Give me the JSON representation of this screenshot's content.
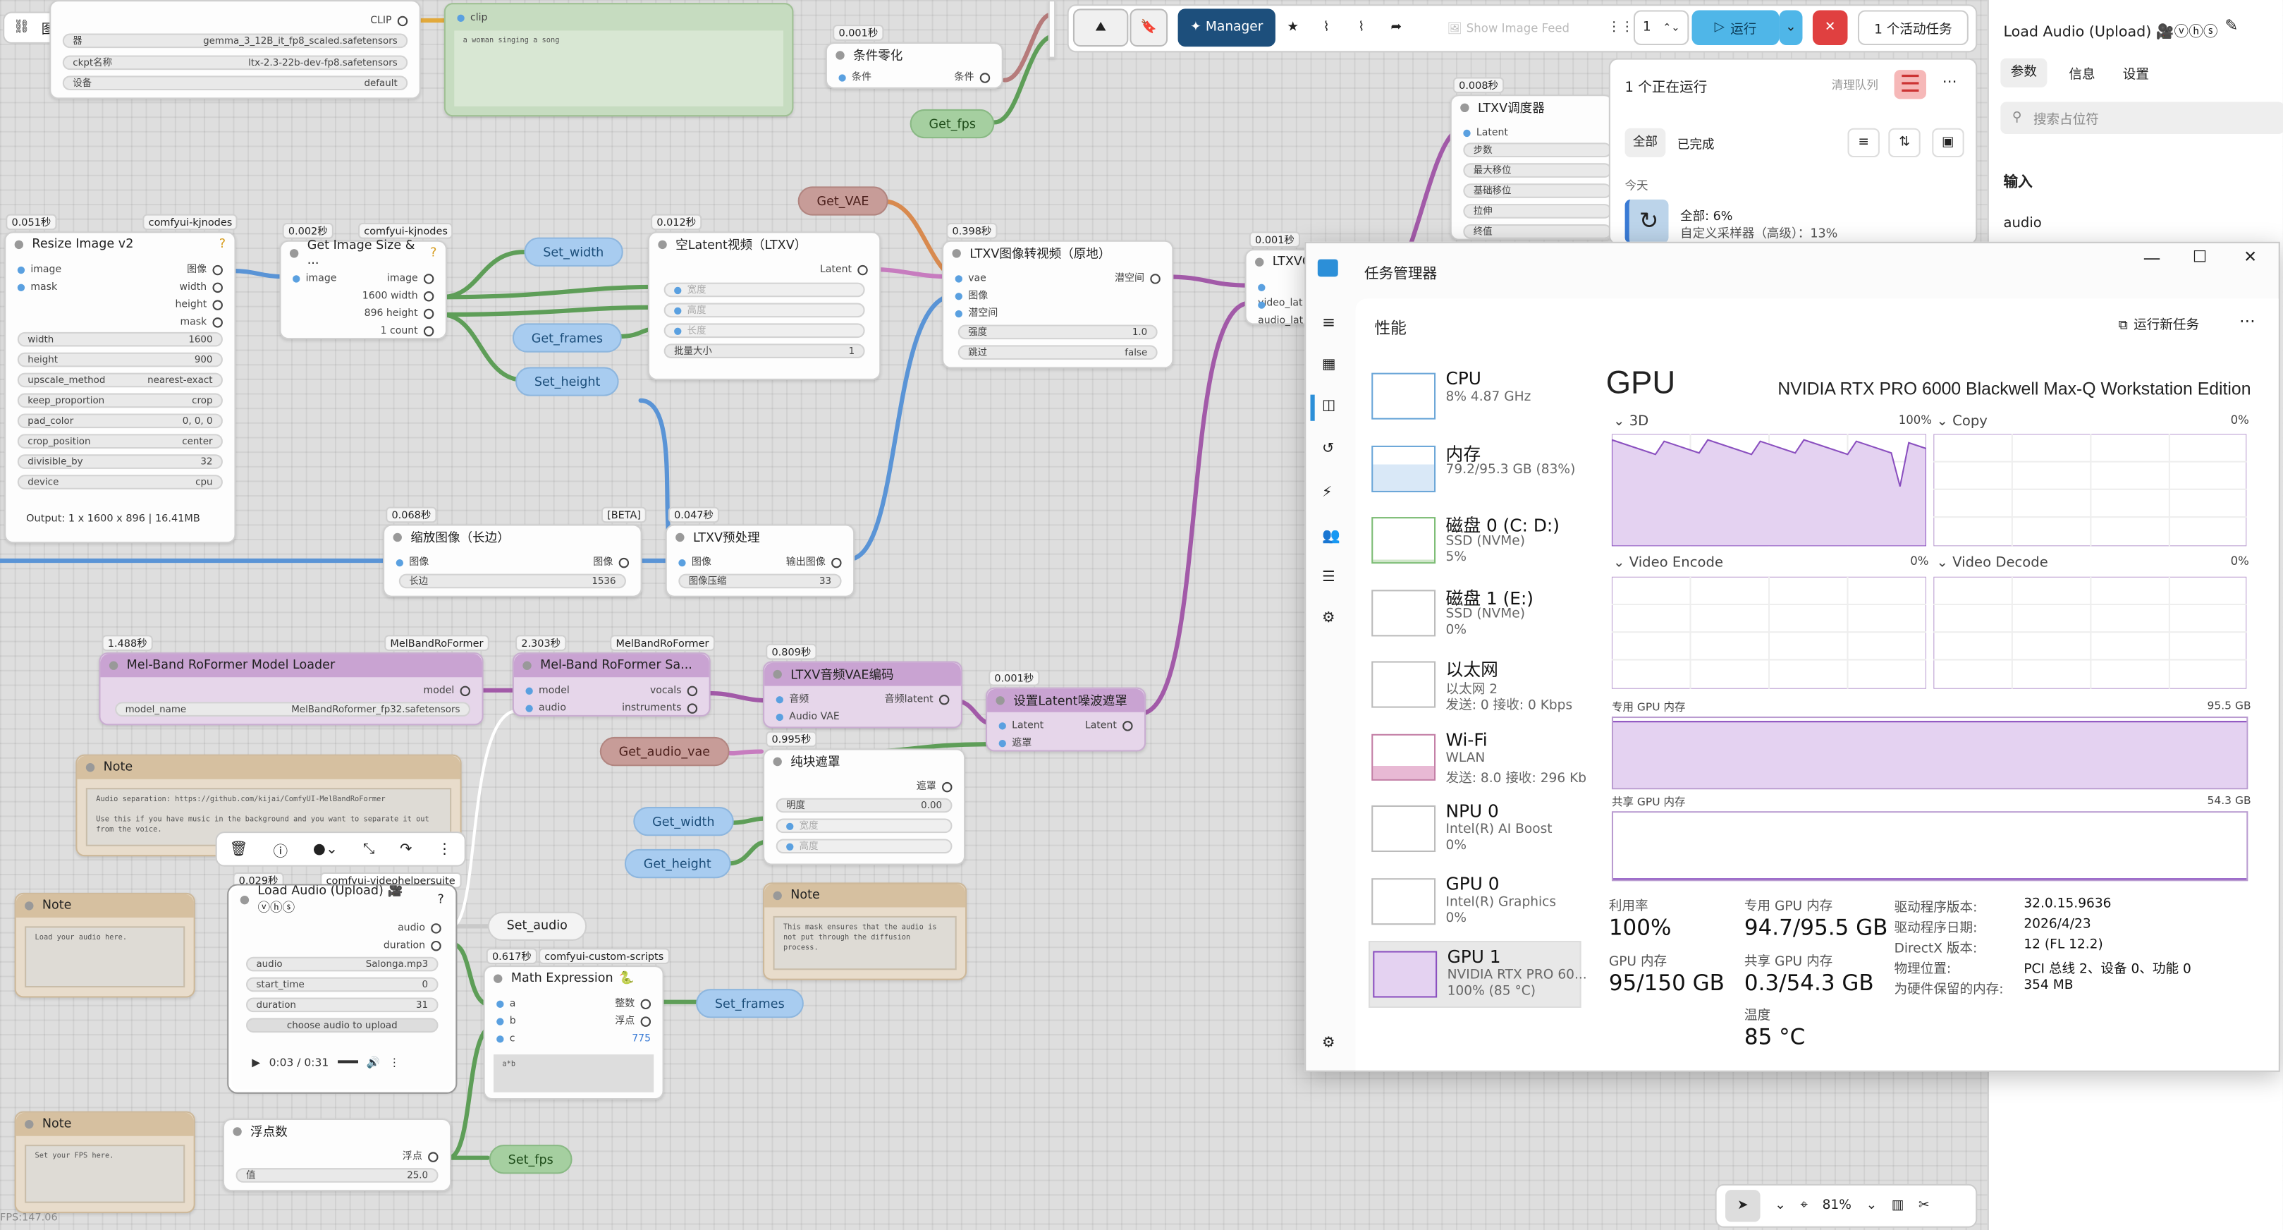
{
  "canvas": {
    "graph_menu": "图形",
    "wires_color": "#7e9e74",
    "nodes": {
      "loader_top": {
        "label_clip": "CLIP",
        "ckpt_value": "gemma_3_12B_it_fp8_scaled.safetensors",
        "ckpt_label": "ckpt名称",
        "ckpt_value2": "ltx-2.3-22b-dev-fp8.safetensors",
        "device_label": "设备",
        "device_value": "default",
        "w1_prefix": "器"
      },
      "prompt": {
        "clip": "clip",
        "text": "a woman singing a song"
      },
      "cond_zero": {
        "time": "0.001秒",
        "title": "条件零化",
        "in": "条件",
        "out": "条件"
      },
      "get_fps": "Get_fps",
      "resize": {
        "time": "0.051秒",
        "pack": "comfyui-kjnodes",
        "title": "Resize Image v2",
        "in1": "image",
        "in2": "mask",
        "out1": "图像",
        "out2": "width",
        "out3": "height",
        "out4": "mask",
        "widgets": [
          [
            "width",
            "1600"
          ],
          [
            "height",
            "900"
          ],
          [
            "upscale_method",
            "nearest-exact"
          ],
          [
            "keep_proportion",
            "crop"
          ],
          [
            "pad_color",
            "0, 0, 0"
          ],
          [
            "crop_position",
            "center"
          ],
          [
            "divisible_by",
            "32"
          ],
          [
            "device",
            "cpu"
          ]
        ],
        "output_text": "Output: 1 x 1600 x 896 | 16.41MB"
      },
      "getsize": {
        "time": "0.002秒",
        "pack": "comfyui-kjnodes",
        "title": "Get Image Size & ...",
        "in": "image",
        "out1": "image",
        "out2": "1600 width",
        "out3": "896 height",
        "out4": "1 count"
      },
      "set_width": "Set_width",
      "get_frames": "Get_frames",
      "set_height": "Set_height",
      "empty_latent": {
        "time": "0.012秒",
        "title": "空Latent视频（LTXV）",
        "out": "Latent",
        "w1": "宽度",
        "w2": "高度",
        "w3": "长度",
        "w4": "批量大小",
        "w4v": "1"
      },
      "get_vae": "Get_VAE",
      "img2vid": {
        "time": "0.398秒",
        "title": "LTXV图像转视频（原地）",
        "in1": "vae",
        "in2": "图像",
        "in3": "潜空间",
        "out": "潜空间",
        "w1": "强度",
        "w1v": "1.0",
        "w2": "跳过",
        "w2v": "false"
      },
      "ltxvc": {
        "time": "0.001秒",
        "title": "LTXVC",
        "in1": "video_lat",
        "in2": "audio_lat"
      },
      "scheduler": {
        "time": "0.008秒",
        "title": "LTXV调度器",
        "in": "Latent",
        "w": [
          "步数",
          "最大移位",
          "基础移位",
          "拉伸",
          "终值"
        ]
      },
      "scale": {
        "time": "0.068秒",
        "beta": "[BETA]",
        "title": "缩放图像（长边）",
        "in": "图像",
        "out": "图像",
        "w": "长边",
        "wv": "1536"
      },
      "preproc": {
        "time": "0.047秒",
        "title": "LTXV预处理",
        "in": "图像",
        "out": "输出图像",
        "w": "图像压缩",
        "wv": "33"
      },
      "mel_loader": {
        "time": "1.488秒",
        "pack": "MelBandRoFormer",
        "title": "Mel-Band RoFormer Model Loader",
        "out": "model",
        "w": "model_name",
        "wv": "MelBandRoformer_fp32.safetensors"
      },
      "mel_sampler": {
        "time": "2.303秒",
        "pack": "MelBandRoFormer",
        "title": "Mel-Band RoFormer Sa...",
        "in1": "model",
        "in2": "audio",
        "out1": "vocals",
        "out2": "instruments"
      },
      "audio_vae": {
        "time": "0.809秒",
        "title": "LTXV音频VAE编码",
        "in1": "音频",
        "in2": "Audio VAE",
        "out": "音频latent"
      },
      "get_audio_vae": "Get_audio_vae",
      "noise_mask": {
        "time": "0.001秒",
        "title": "设置Latent噪波遮罩",
        "in1": "Latent",
        "in2": "遮罩",
        "out": "Latent"
      },
      "solid_mask": {
        "time": "0.995秒",
        "title": "纯块遮罩",
        "out": "遮罩",
        "w1": "明度",
        "w1v": "0.00",
        "w2": "宽度",
        "w3": "高度"
      },
      "get_width": "Get_width",
      "get_height": "Get_height",
      "note1": {
        "title": "Note",
        "text": "Audio separation: https://github.com/kijai/ComfyUI-MelBandRoFormer\n\nUse this if you have music in the background and you want to separate it out from the voice."
      },
      "note2": {
        "title": "Note",
        "text": "Load your audio here."
      },
      "note3": {
        "title": "Note",
        "text": "This mask ensures that the audio is not put through the diffusion process."
      },
      "note4": {
        "title": "Note",
        "text": "Set your FPS here."
      },
      "load_audio": {
        "time": "0.029秒",
        "pack": "comfyui-videohelpersuite",
        "title": "Load Audio (Upload) 🎥ⓥⓗⓢ",
        "out1": "audio",
        "out2": "duration",
        "w": [
          [
            "audio",
            "Salonga.mp3"
          ],
          [
            "start_time",
            "0"
          ],
          [
            "duration",
            "31"
          ]
        ],
        "upload": "choose audio to upload",
        "player_time": "0:03 / 0:31"
      },
      "set_audio": "Set_audio",
      "math": {
        "time": "0.617秒",
        "pack": "comfyui-custom-scripts",
        "title": "Math Expression",
        "in1": "a",
        "in2": "b",
        "in3": "c",
        "out1": "整数",
        "out2": "浮点",
        "result": "775",
        "expr": "a*b"
      },
      "set_frames": "Set_frames",
      "float_node": {
        "title": "浮点数",
        "out": "浮点",
        "w": "值",
        "wv": "25.0"
      },
      "set_fps": "Set_fps",
      "fps_readout": "FPS:147.06"
    }
  },
  "toolbar": {
    "manager": "Manager",
    "show_image_feed": "Show Image Feed",
    "queue_count": "1",
    "run": "运行",
    "active_tasks": "1 个活动任务"
  },
  "queue": {
    "title": "1 个正在运行",
    "clear": "清理队列",
    "tab_all": "全部",
    "tab_done": "已完成",
    "today": "今天",
    "task_name": "全部: 6%",
    "task_sub": "自定义采样器（高级）：13%"
  },
  "right_panel": {
    "title": "Load Audio (Upload) 🎥ⓥⓗⓢ",
    "tabs": [
      "参数",
      "信息",
      "设置"
    ],
    "search_placeholder": "搜索占位符",
    "section": "输入",
    "field": "audio"
  },
  "bottom_bar": {
    "zoom": "81%"
  },
  "task_manager": {
    "window_title": "任务管理器",
    "section": "性能",
    "run_new_task": "运行新任务",
    "items": [
      {
        "name": "CPU",
        "s1": "8% 4.87 GHz",
        "s2": ""
      },
      {
        "name": "内存",
        "s1": "79.2/95.3 GB (83%)",
        "s2": ""
      },
      {
        "name": "磁盘 0 (C: D:)",
        "s1": "SSD (NVMe)",
        "s2": "5%"
      },
      {
        "name": "磁盘 1 (E:)",
        "s1": "SSD (NVMe)",
        "s2": "0%"
      },
      {
        "name": "以太网",
        "s1": "以太网 2",
        "s2": "发送: 0 接收: 0 Kbps"
      },
      {
        "name": "Wi-Fi",
        "s1": "WLAN",
        "s2": "发送: 8.0 接收: 296 Kb"
      },
      {
        "name": "NPU 0",
        "s1": "Intel(R) AI Boost",
        "s2": "0%"
      },
      {
        "name": "GPU 0",
        "s1": "Intel(R) Graphics",
        "s2": "0%"
      },
      {
        "name": "GPU 1",
        "s1": "NVIDIA RTX PRO 60...",
        "s2": "100% (85 °C)"
      }
    ],
    "gpu_heading": "GPU",
    "gpu_model": "NVIDIA RTX PRO 6000 Blackwell Max-Q Workstation Edition",
    "graph_3d": "3D",
    "graph_3d_pct": "100%",
    "graph_copy": "Copy",
    "graph_copy_pct": "0%",
    "graph_venc": "Video Encode",
    "graph_venc_pct": "0%",
    "graph_vdec": "Video Decode",
    "graph_vdec_pct": "0%",
    "dedicated_label": "专用 GPU 内存",
    "dedicated_max": "95.5 GB",
    "shared_label": "共享 GPU 内存",
    "shared_max": "54.3 GB",
    "stats": {
      "util_l": "利用率",
      "util_v": "100%",
      "ded_l": "专用 GPU 内存",
      "ded_v": "94.7/95.5 GB",
      "gpu_mem_l": "GPU 内存",
      "gpu_mem_v": "95/150 GB",
      "sh_l": "共享 GPU 内存",
      "sh_v": "0.3/54.3 GB",
      "temp_l": "温度",
      "temp_v": "85 °C",
      "drv_ver_l": "驱动程序版本:",
      "drv_ver_v": "32.0.15.9636",
      "drv_date_l": "驱动程序日期:",
      "drv_date_v": "2026/4/23",
      "dx_l": "DirectX 版本:",
      "dx_v": "12 (FL 12.2)",
      "loc_l": "物理位置:",
      "loc_v": "PCI 总线 2、设备 0、功能 0",
      "res_l": "为硬件保留的内存:",
      "res_v": "354 MB"
    },
    "accent": "#8a4fbf"
  }
}
